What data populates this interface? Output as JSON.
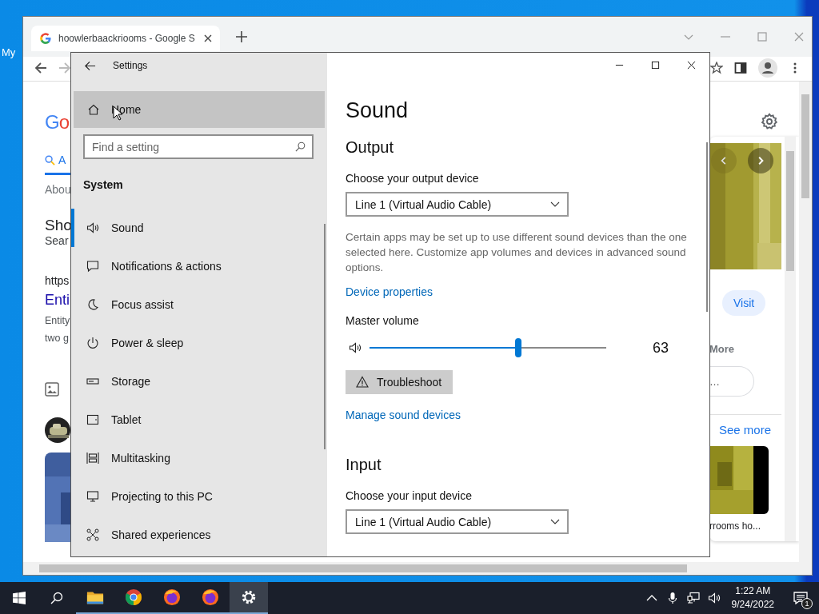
{
  "desktop": {
    "icon_label": "My"
  },
  "browser": {
    "tab": {
      "title": "hoowlerbaackriooms - Google S",
      "selected": true
    },
    "page": {
      "logo": "Go",
      "all_tab": {
        "label": "A",
        "selected": true
      },
      "about": "Abou",
      "heading": "Sho",
      "subheading": "Sear",
      "url": "https",
      "result_title": "Enti",
      "snippet": [
        "Entity",
        "two g"
      ]
    },
    "side_panel": {
      "visit": "Visit",
      "more": "More",
      "more_chip": "…",
      "see_more": "See more",
      "video_caption": "rrooms ho..."
    }
  },
  "settings": {
    "title": "Settings",
    "home": {
      "label": "Home",
      "hovered": true
    },
    "search": {
      "placeholder": "Find a setting"
    },
    "section": "System",
    "nav": [
      {
        "kind": "sound",
        "label": "Sound",
        "selected": true
      },
      {
        "kind": "notifications",
        "label": "Notifications & actions",
        "selected": false
      },
      {
        "kind": "focus",
        "label": "Focus assist",
        "selected": false
      },
      {
        "kind": "power",
        "label": "Power & sleep",
        "selected": false
      },
      {
        "kind": "storage",
        "label": "Storage",
        "selected": false
      },
      {
        "kind": "tablet",
        "label": "Tablet",
        "selected": false
      },
      {
        "kind": "multitasking",
        "label": "Multitasking",
        "selected": false
      },
      {
        "kind": "projecting",
        "label": "Projecting to this PC",
        "selected": false
      },
      {
        "kind": "shared",
        "label": "Shared experiences",
        "selected": false
      }
    ],
    "page_title": "Sound",
    "output": {
      "heading": "Output",
      "device_label": "Choose your output device",
      "device": "Line 1 (Virtual Audio Cable)",
      "note": "Certain apps may be set up to use different sound devices than the one selected here. Customize app volumes and devices in advanced sound options.",
      "properties_link": "Device properties",
      "volume_label": "Master volume",
      "volume": {
        "level": 0.63,
        "reading": "63"
      },
      "troubleshoot": "Troubleshoot",
      "manage_link": "Manage sound devices"
    },
    "input": {
      "heading": "Input",
      "device_label": "Choose your input device",
      "device": "Line 1 (Virtual Audio Cable)"
    }
  },
  "taskbar": {
    "apps": [
      {
        "kind": "explorer",
        "active": false
      },
      {
        "kind": "chrome",
        "active": false
      },
      {
        "kind": "firefox",
        "active": false
      },
      {
        "kind": "firefox",
        "active": false
      },
      {
        "kind": "settings",
        "active": true
      }
    ],
    "clock": {
      "time": "1:22 AM",
      "date": "9/24/2022"
    },
    "notifications": {
      "count": "1"
    }
  }
}
